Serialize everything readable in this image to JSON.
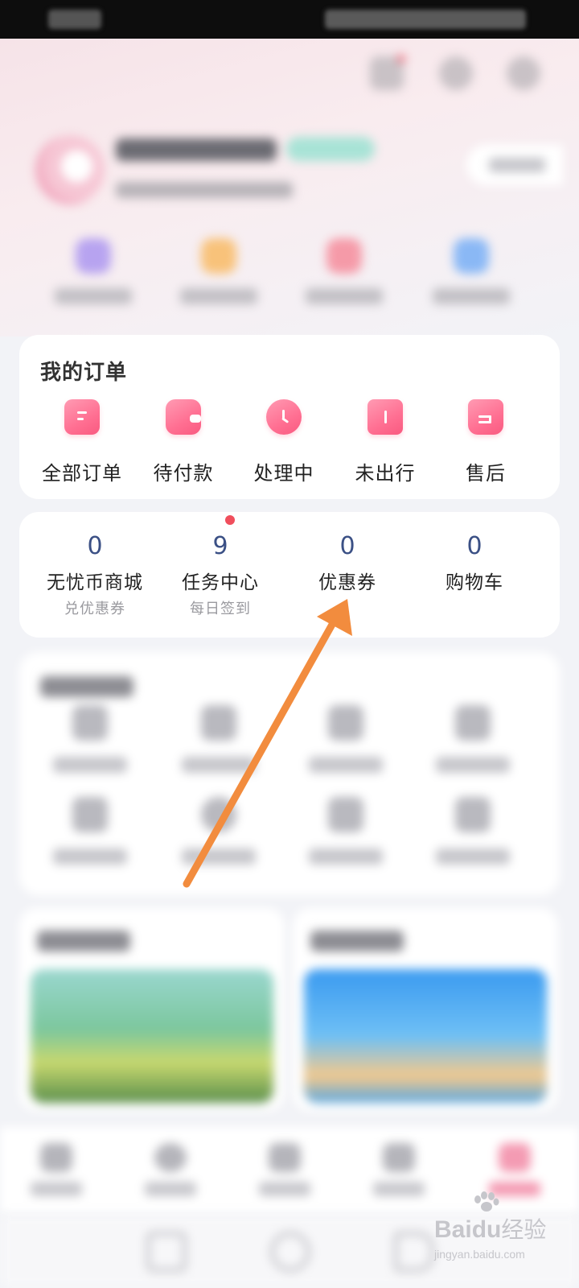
{
  "orders": {
    "title": "我的订单",
    "items": [
      {
        "label": "全部订单",
        "icon": "document-list-icon"
      },
      {
        "label": "待付款",
        "icon": "wallet-icon"
      },
      {
        "label": "处理中",
        "icon": "clock-icon"
      },
      {
        "label": "未出行",
        "icon": "ticket-icon"
      },
      {
        "label": "售后",
        "icon": "return-bag-icon"
      }
    ]
  },
  "stats": [
    {
      "num": "0",
      "label": "无忧币商城",
      "sub": "兑优惠券"
    },
    {
      "num": "9",
      "label": "任务中心",
      "sub": "每日签到",
      "has_dot": true
    },
    {
      "num": "0",
      "label": "优惠券",
      "sub": ""
    },
    {
      "num": "0",
      "label": "购物车",
      "sub": ""
    }
  ],
  "annotation": {
    "color": "#f28c3e",
    "points_to": "优惠券"
  },
  "watermark": {
    "brand_prefix": "Bai",
    "brand_suffix": "du",
    "brand_cn": "经验",
    "url": "jingyan.baidu.com"
  },
  "colors": {
    "accent": "#ff6f92",
    "stat_number": "#3b5085",
    "dot": "#f04e5c"
  }
}
